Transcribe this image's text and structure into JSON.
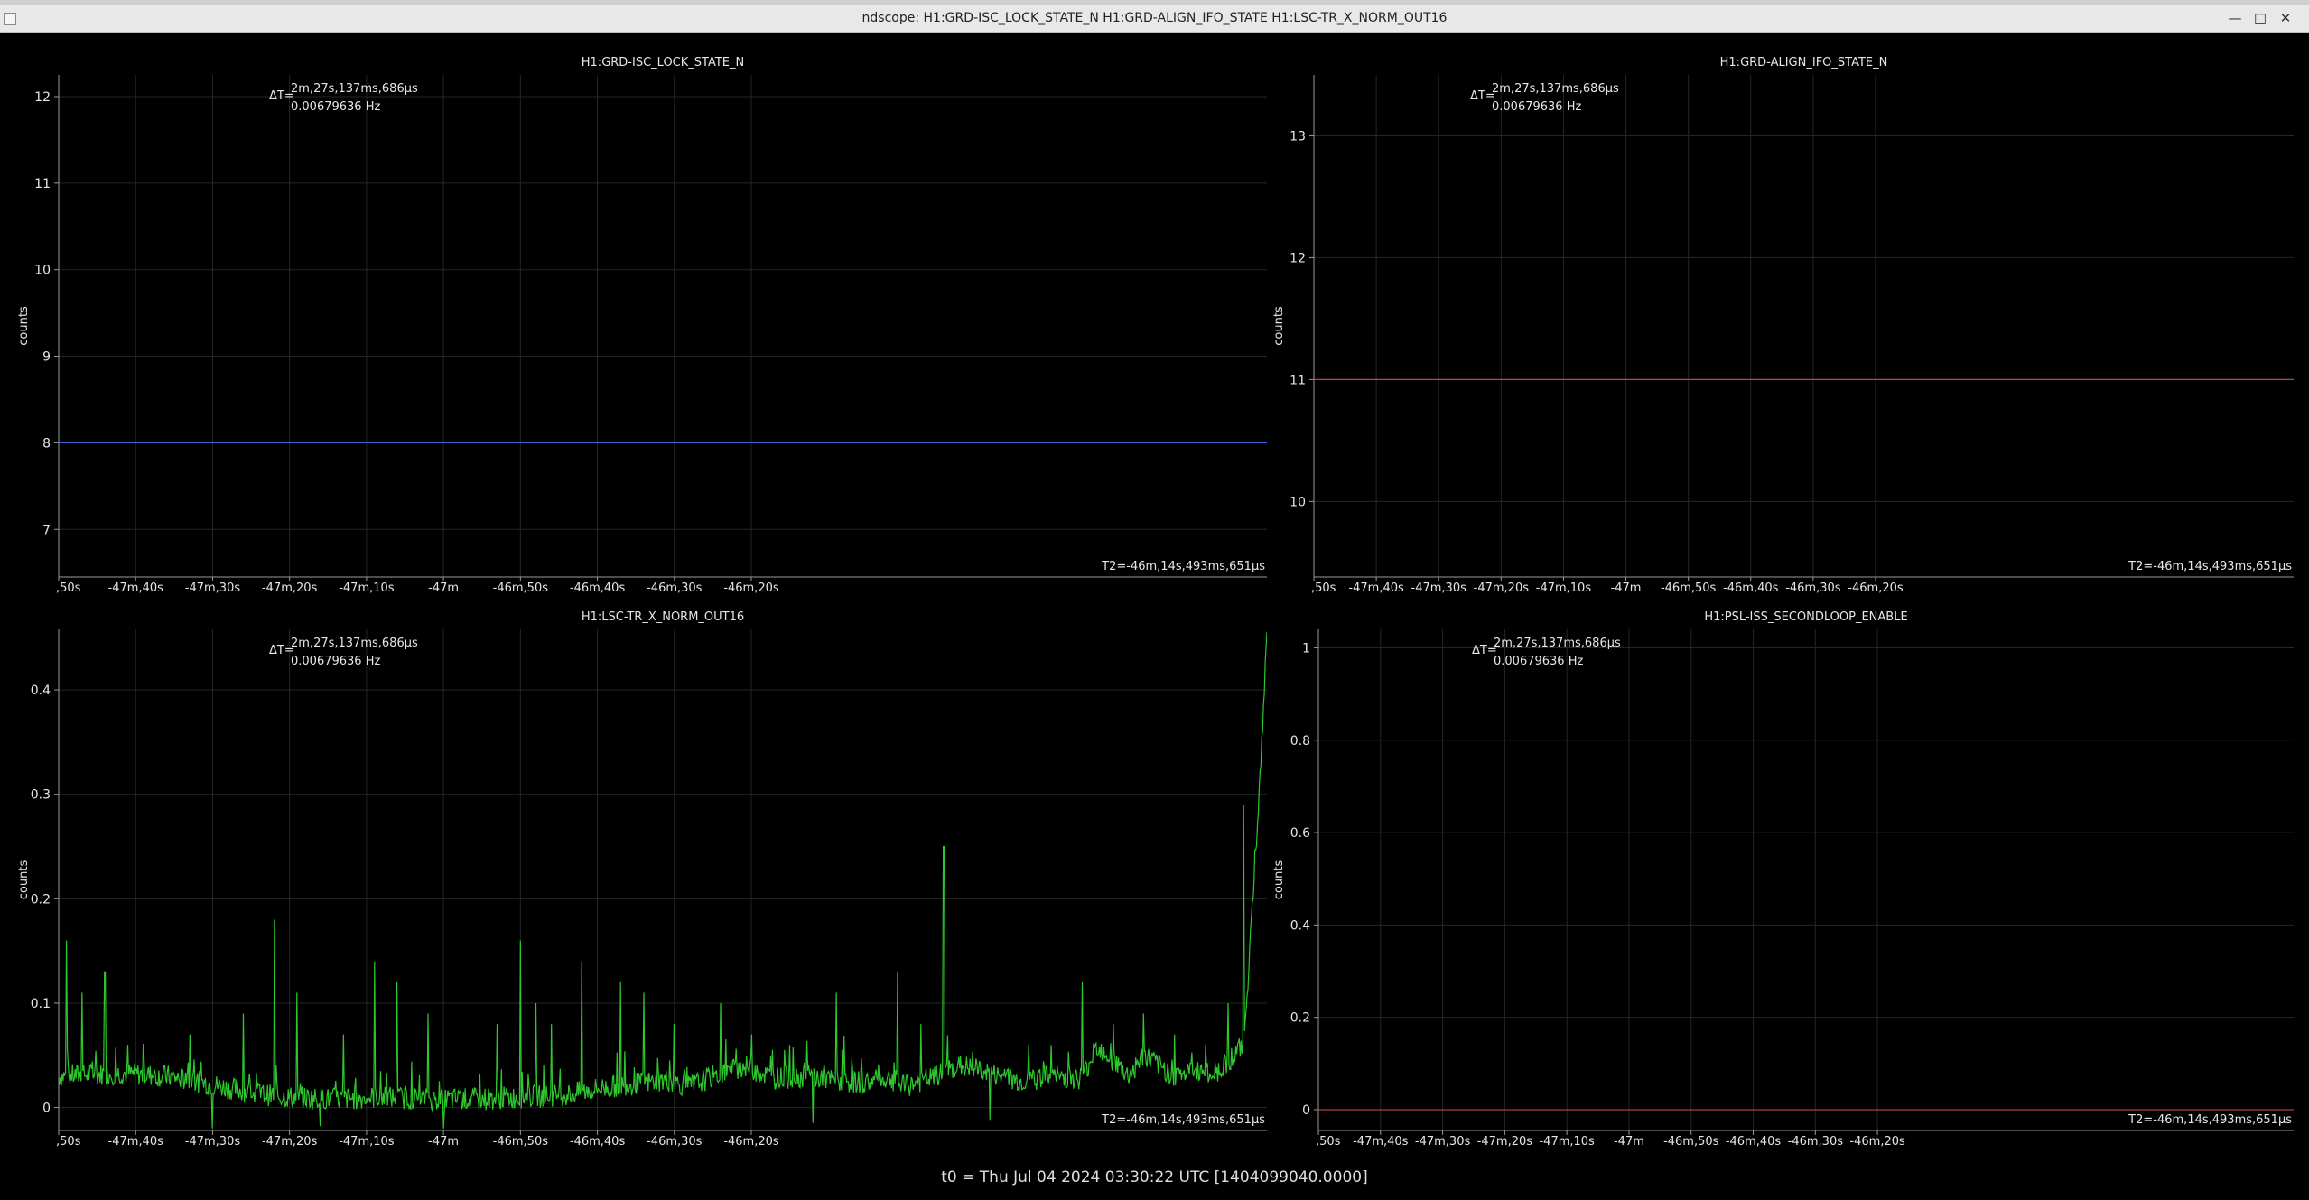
{
  "window": {
    "title": "ndscope: H1:GRD-ISC_LOCK_STATE_N H1:GRD-ALIGN_IFO_STATE H1:LSC-TR_X_NORM_OUT16"
  },
  "footer": {
    "t0_text": "t0 = Thu Jul 04 2024 03:30:22 UTC [1404099040.0000]"
  },
  "cursor": {
    "delta_label": "ΔT=",
    "delta_t": "2m,27s,137ms,686µs",
    "freq": "0.00679636 Hz",
    "t2_label": "T2=-46m,14s,493ms,651µs"
  },
  "colors": {
    "background": "#000000",
    "grid": "#262626",
    "axis": "#9a9a9a",
    "text": "#e6e6e6"
  },
  "chart_data": [
    {
      "type": "line",
      "title": "H1:GRD-ISC_LOCK_STATE_N",
      "ylabel": "counts",
      "xlabel": "",
      "xlim": [
        -2870,
        -2713
      ],
      "ylim": [
        6.45,
        12.25
      ],
      "yticks": [
        7,
        8,
        9,
        10,
        11,
        12
      ],
      "ytick_labels": [
        "7",
        "8",
        "9",
        "10",
        "11",
        "12"
      ],
      "xticks": [
        -2870,
        -2860,
        -2850,
        -2840,
        -2830,
        -2820,
        -2810,
        -2800,
        -2790,
        -2780
      ],
      "xtick_labels": [
        ",50s",
        "-47m,40s",
        "-47m,30s",
        "-47m,20s",
        "-47m,10s",
        "-47m",
        "-46m,50s",
        "-46m,40s",
        "-46m,30s",
        "-46m,20s"
      ],
      "grid": true,
      "series": [
        {
          "color": "#3c64dc",
          "x": [
            -2870,
            -2713
          ],
          "values": [
            8,
            8
          ]
        }
      ]
    },
    {
      "type": "line",
      "title": "H1:GRD-ALIGN_IFO_STATE_N",
      "ylabel": "counts",
      "xlabel": "",
      "xlim": [
        -2870,
        -2713
      ],
      "ylim": [
        9.38,
        13.5
      ],
      "yticks": [
        10,
        11,
        12,
        13
      ],
      "ytick_labels": [
        "10",
        "11",
        "12",
        "13"
      ],
      "xticks": [
        -2870,
        -2860,
        -2850,
        -2840,
        -2830,
        -2820,
        -2810,
        -2800,
        -2790,
        -2780
      ],
      "xtick_labels": [
        ",50s",
        "-47m,40s",
        "-47m,30s",
        "-47m,20s",
        "-47m,10s",
        "-47m",
        "-46m,50s",
        "-46m,40s",
        "-46m,30s",
        "-46m,20s"
      ],
      "grid": true,
      "series": [
        {
          "color": "#d03c3c",
          "x": [
            -2870,
            -2713
          ],
          "values": [
            11,
            11
          ]
        }
      ]
    },
    {
      "type": "line",
      "title": "H1:LSC-TR_X_NORM_OUT16",
      "ylabel": "counts",
      "xlabel": "",
      "xlim": [
        -2870,
        -2713
      ],
      "ylim": [
        -0.022,
        0.458
      ],
      "yticks": [
        0,
        0.1,
        0.2,
        0.3,
        0.4
      ],
      "ytick_labels": [
        "0",
        "0.1",
        "0.2",
        "0.3",
        "0.4"
      ],
      "xticks": [
        -2870,
        -2860,
        -2850,
        -2840,
        -2830,
        -2820,
        -2810,
        -2800,
        -2790,
        -2780
      ],
      "xtick_labels": [
        ",50s",
        "-47m,40s",
        "-47m,30s",
        "-47m,20s",
        "-47m,10s",
        "-47m",
        "-46m,50s",
        "-46m,40s",
        "-46m,30s",
        "-46m,20s"
      ],
      "grid": true,
      "series": [
        {
          "color": "#2ec82e",
          "baseline": [
            [
              -2870,
              0.03
            ],
            [
              -2862,
              0.033
            ],
            [
              -2856,
              0.03
            ],
            [
              -2850,
              0.022
            ],
            [
              -2845,
              0.014
            ],
            [
              -2840,
              0.01
            ],
            [
              -2834,
              0.008
            ],
            [
              -2828,
              0.01
            ],
            [
              -2822,
              0.008
            ],
            [
              -2816,
              0.008
            ],
            [
              -2810,
              0.01
            ],
            [
              -2804,
              0.012
            ],
            [
              -2800,
              0.018
            ],
            [
              -2796,
              0.022
            ],
            [
              -2791,
              0.026
            ],
            [
              -2788,
              0.02
            ],
            [
              -2785,
              0.03
            ],
            [
              -2781,
              0.04
            ],
            [
              -2777,
              0.028
            ],
            [
              -2773,
              0.03
            ],
            [
              -2769,
              0.025
            ],
            [
              -2765,
              0.024
            ],
            [
              -2762,
              0.028
            ],
            [
              -2760,
              0.02
            ],
            [
              -2756,
              0.03
            ],
            [
              -2753,
              0.04
            ],
            [
              -2750,
              0.035
            ],
            [
              -2748,
              0.03
            ],
            [
              -2745,
              0.025
            ],
            [
              -2741,
              0.03
            ],
            [
              -2737,
              0.028
            ],
            [
              -2735,
              0.06
            ],
            [
              -2733,
              0.045
            ],
            [
              -2731,
              0.03
            ],
            [
              -2729,
              0.05
            ],
            [
              -2727,
              0.04
            ],
            [
              -2725,
              0.03
            ],
            [
              -2722,
              0.035
            ],
            [
              -2720,
              0.03
            ],
            [
              -2718,
              0.045
            ],
            [
              -2716,
              0.06
            ],
            [
              -2714,
              0.3
            ],
            [
              -2713,
              0.45
            ]
          ],
          "spikes": [
            [
              -2869,
              0.16
            ],
            [
              -2867,
              0.11
            ],
            [
              -2864,
              0.13
            ],
            [
              -2861,
              0.06
            ],
            [
              -2853,
              0.07
            ],
            [
              -2850,
              0.2
            ],
            [
              -2846,
              0.09
            ],
            [
              -2842,
              0.18
            ],
            [
              -2839,
              0.11
            ],
            [
              -2836,
              0.19
            ],
            [
              -2833,
              0.07
            ],
            [
              -2829,
              0.14
            ],
            [
              -2826,
              0.12
            ],
            [
              -2822,
              0.09
            ],
            [
              -2813,
              0.08
            ],
            [
              -2810,
              0.16
            ],
            [
              -2808,
              0.1
            ],
            [
              -2806,
              0.08
            ],
            [
              -2802,
              0.14
            ],
            [
              -2797,
              0.12
            ],
            [
              -2794,
              0.11
            ],
            [
              -2790,
              0.08
            ],
            [
              -2784,
              0.1
            ],
            [
              -2780,
              0.07
            ],
            [
              -2775,
              0.06
            ],
            [
              -2769,
              0.11
            ],
            [
              -2761,
              0.13
            ],
            [
              -2758,
              0.08
            ],
            [
              -2755,
              0.25
            ],
            [
              -2749,
              0.11
            ],
            [
              -2744,
              0.06
            ],
            [
              -2741,
              0.06
            ],
            [
              -2737,
              0.12
            ],
            [
              -2733,
              0.08
            ],
            [
              -2729,
              0.09
            ],
            [
              -2725,
              0.07
            ],
            [
              -2721,
              0.06
            ],
            [
              -2718,
              0.1
            ],
            [
              -2716,
              0.29
            ]
          ],
          "dips": [
            [
              -2850,
              -0.02
            ],
            [
              -2836,
              -0.018
            ],
            [
              -2820,
              -0.02
            ],
            [
              -2772,
              -0.015
            ],
            [
              -2749,
              -0.012
            ]
          ]
        }
      ]
    },
    {
      "type": "line",
      "title": "H1:PSL-ISS_SECONDLOOP_ENABLE",
      "ylabel": "counts",
      "xlabel": "",
      "xlim": [
        -2870,
        -2713
      ],
      "ylim": [
        -0.045,
        1.04
      ],
      "yticks": [
        0,
        0.2,
        0.4,
        0.6,
        0.8,
        1
      ],
      "ytick_labels": [
        "0",
        "0.2",
        "0.4",
        "0.6",
        "0.8",
        "1"
      ],
      "xticks": [
        -2870,
        -2860,
        -2850,
        -2840,
        -2830,
        -2820,
        -2810,
        -2800,
        -2790,
        -2780
      ],
      "xtick_labels": [
        ",50s",
        "-47m,40s",
        "-47m,30s",
        "-47m,20s",
        "-47m,10s",
        "-47m",
        "-46m,50s",
        "-46m,40s",
        "-46m,30s",
        "-46m,20s"
      ],
      "grid": true,
      "series": [
        {
          "color": "#b43c3c",
          "x": [
            -2870,
            -2713
          ],
          "values": [
            0,
            0
          ]
        }
      ]
    }
  ]
}
